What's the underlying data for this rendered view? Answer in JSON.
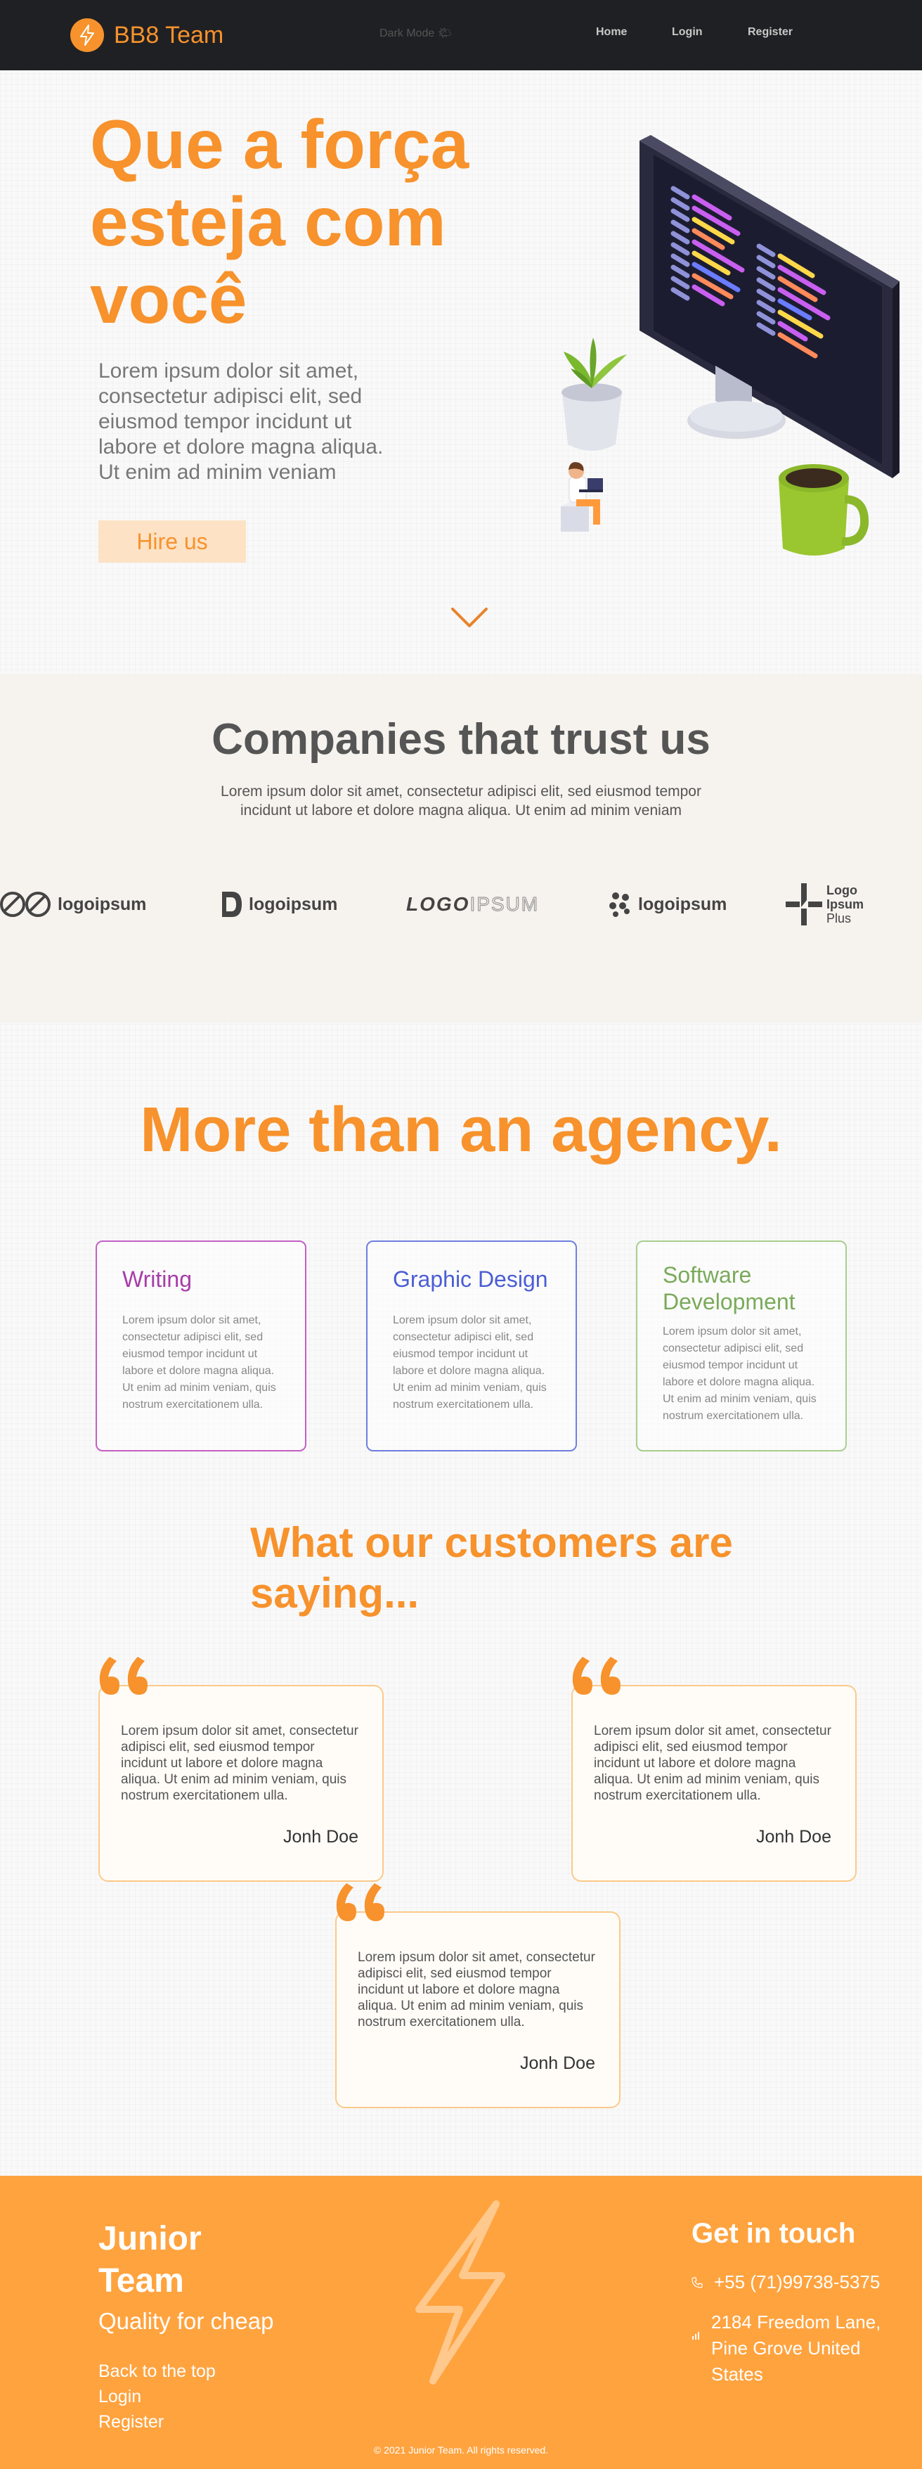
{
  "nav": {
    "brand": "BB8 Team",
    "dark_mode": "Dark Mode 🌤",
    "links": [
      "Home",
      "Login",
      "Register"
    ]
  },
  "hero": {
    "title": "Que a força esteja com você",
    "text": "Lorem ipsum dolor sit amet, consectetur adipisci elit, sed eiusmod tempor incidunt ut labore et dolore magna aliqua. Ut enim ad minim veniam",
    "cta": "Hire us"
  },
  "companies": {
    "title": "Companies that trust us",
    "text": "Lorem ipsum dolor sit amet, consectetur adipisci elit, sed eiusmod tempor incidunt ut labore et dolore magna aliqua. Ut enim ad minim veniam",
    "logos": [
      "logoipsum",
      "logoipsum",
      "LOGO",
      "IPSUM",
      "logoipsum",
      "Logo",
      "Ipsum",
      "Plus"
    ]
  },
  "agency": {
    "title": "More than an agency.",
    "cards": [
      {
        "title": "Writing",
        "text": "Lorem ipsum dolor sit amet, consectetur adipisci elit, sed eiusmod tempor incidunt ut labore et dolore magna aliqua. Ut enim ad minim veniam, quis nostrum exercitationem ulla.",
        "color": "#a73caa"
      },
      {
        "title": "Graphic Design",
        "text": "Lorem ipsum dolor sit amet, consectetur adipisci elit, sed eiusmod tempor incidunt ut labore et dolore magna aliqua. Ut enim ad minim veniam, quis nostrum exercitationem ulla.",
        "color": "#4b5ed4"
      },
      {
        "title": "Software Development",
        "text": "Lorem ipsum dolor sit amet, consectetur adipisci elit, sed eiusmod tempor incidunt ut labore et dolore magna aliqua. Ut enim ad minim veniam, quis nostrum exercitationem ulla.",
        "color": "#7aaa5a"
      }
    ]
  },
  "testimonials": {
    "title": "What our customers are saying...",
    "items": [
      {
        "text": "Lorem ipsum dolor sit amet, consectetur adipisci elit, sed eiusmod tempor incidunt ut labore et dolore magna aliqua. Ut enim ad minim veniam, quis nostrum exercitationem ulla.",
        "author": "Jonh Doe"
      },
      {
        "text": "Lorem ipsum dolor sit amet, consectetur adipisci elit, sed eiusmod tempor incidunt ut labore et dolore magna aliqua. Ut enim ad minim veniam, quis nostrum exercitationem ulla.",
        "author": "Jonh Doe"
      },
      {
        "text": "Lorem ipsum dolor sit amet, consectetur adipisci elit, sed eiusmod tempor incidunt ut labore et dolore magna aliqua. Ut enim ad minim veniam, quis nostrum exercitationem ulla.",
        "author": "Jonh Doe"
      }
    ]
  },
  "footer": {
    "title": "Junior Team",
    "subtitle": "Quality for cheap",
    "links": [
      "Back to the top",
      "Login",
      "Register"
    ],
    "contact_title": "Get in touch",
    "phone": "+55 (71)99738-5375",
    "address": "2184 Freedom Lane, Pine Grove United States",
    "copyright": "© 2021 Junior Team. All rights reserved."
  },
  "colors": {
    "accent": "#f7922c",
    "nav_bg": "#1f2023",
    "footer_bg": "#ffa33f"
  }
}
